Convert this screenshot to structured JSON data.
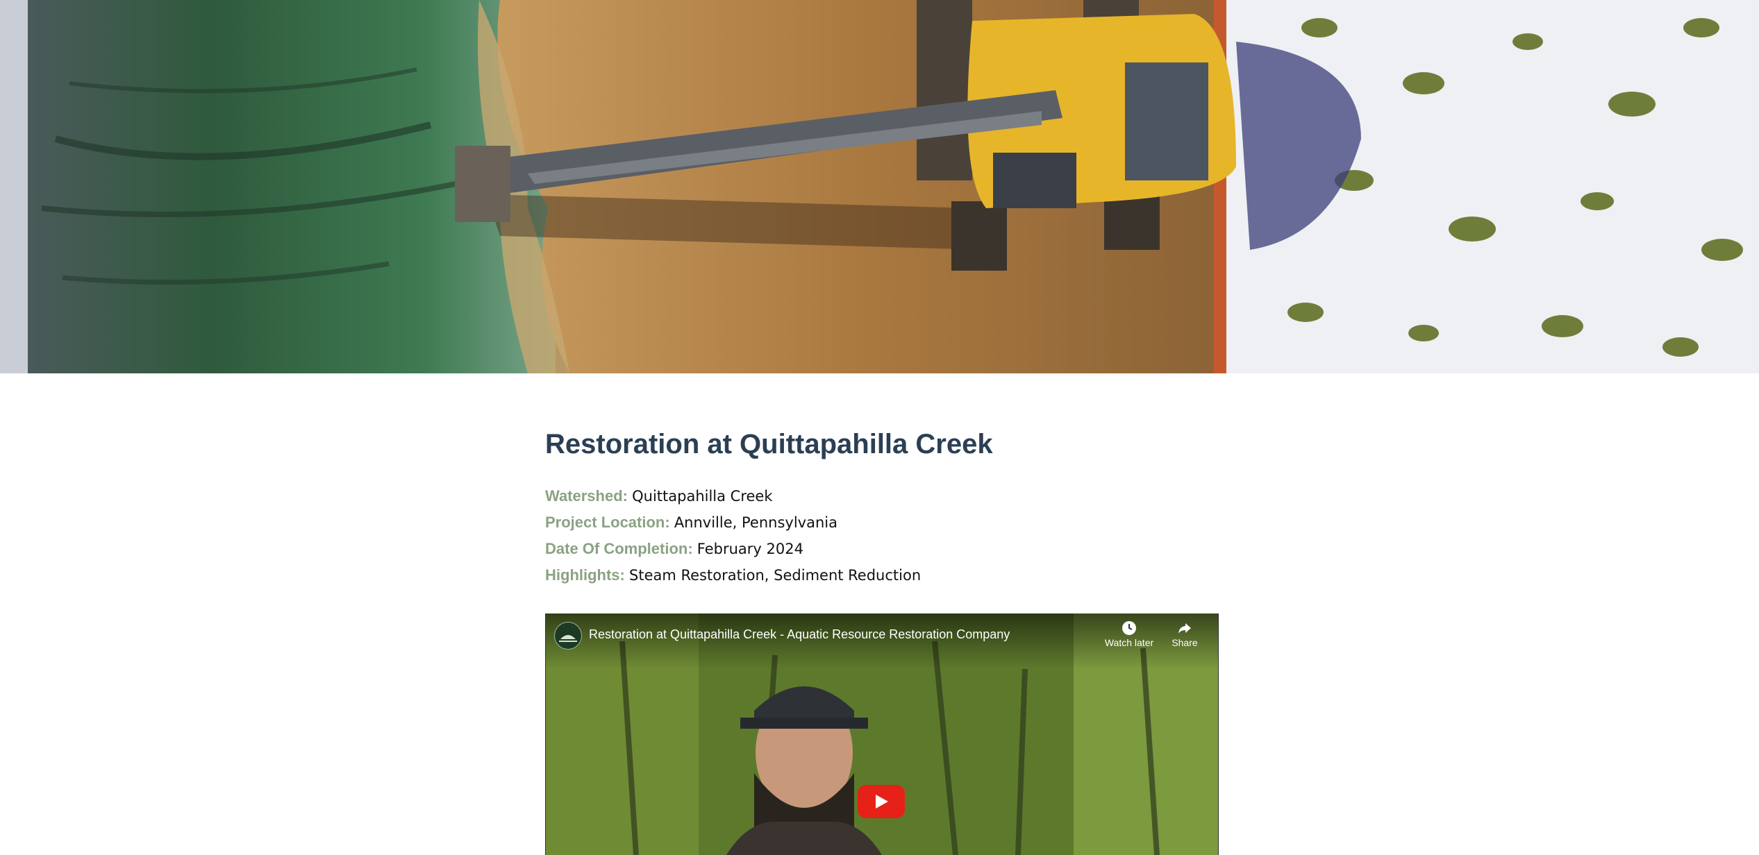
{
  "hero": {
    "image": "aerial-excavator-creek-restoration-photo"
  },
  "project": {
    "title": "Restoration at Quittapahilla Creek",
    "fields": [
      {
        "label": "Watershed:",
        "value": "Quittapahilla Creek"
      },
      {
        "label": "Project Location:",
        "value": "Annville, Pennsylvania"
      },
      {
        "label": "Date Of Completion:",
        "value": "February 2024"
      },
      {
        "label": "Highlights:",
        "value": "Steam Restoration, Sediment Reduction"
      }
    ]
  },
  "video": {
    "title": "Restoration at Quittapahilla Creek - Aquatic Resource Restoration Company",
    "watch_later_label": "Watch later",
    "share_label": "Share",
    "icons": {
      "channel": "channel-logo-icon",
      "watch_later": "clock-icon",
      "share": "share-arrow-icon",
      "play": "play-icon"
    }
  },
  "colors": {
    "title": "#2b3f54",
    "label": "#8aa283",
    "play_button": "#e62117"
  }
}
